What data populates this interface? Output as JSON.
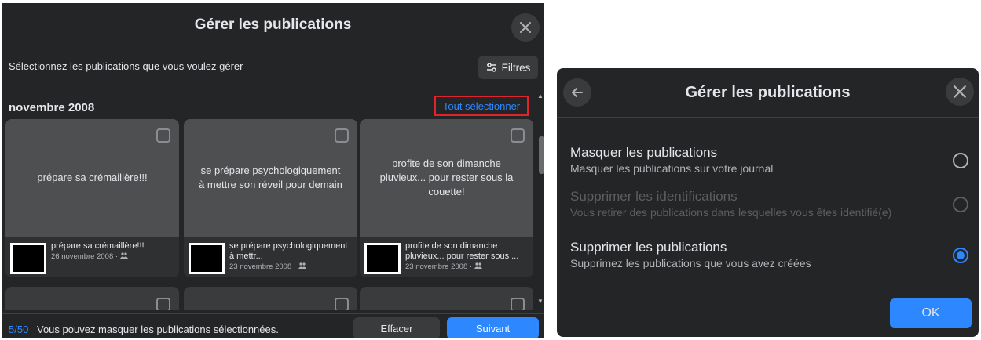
{
  "left": {
    "title": "Gérer les publications",
    "subtitle": "Sélectionnez les publications que vous voulez gérer",
    "filters_label": "Filtres",
    "month": "novembre 2008",
    "select_all": "Tout sélectionner",
    "cards": [
      {
        "text": "prépare sa crémaillère!!!",
        "foot_title": "prépare sa crémaillère!!!",
        "foot_meta": "26 novembre 2008 · "
      },
      {
        "text": "se prépare psychologiquement à mettre son réveil pour demain",
        "foot_title": "se prépare psychologiquement à mettr...",
        "foot_meta": "23 novembre 2008 · "
      },
      {
        "text": "profite de son dimanche pluvieux... pour rester sous la couette!",
        "foot_title": "profite de son dimanche pluvieux... pour rester sous ...",
        "foot_meta": "23 novembre 2008 · "
      }
    ],
    "footer": {
      "count": "5/50",
      "message": "Vous pouvez masquer les publications sélectionnées.",
      "clear_label": "Effacer",
      "next_label": "Suivant"
    }
  },
  "right": {
    "title": "Gérer les publications",
    "options": [
      {
        "title": "Masquer les publications",
        "desc": "Masquer les publications sur votre journal",
        "selected": false,
        "disabled": false
      },
      {
        "title": "Supprimer les identifications",
        "desc": "Vous retirer des publications dans lesquelles vous êtes identifié(e)",
        "selected": false,
        "disabled": true
      },
      {
        "title": "Supprimer les publications",
        "desc": "Supprimez les publications que vous avez créées",
        "selected": true,
        "disabled": false
      }
    ],
    "ok_label": "OK"
  },
  "colors": {
    "accent": "#2d88ff",
    "panel_bg": "#242526",
    "highlight_border": "#e0242f"
  },
  "icons": {
    "close": "close-icon",
    "back": "arrow-left-icon",
    "filters": "sliders-icon",
    "audience": "friends-icon"
  }
}
